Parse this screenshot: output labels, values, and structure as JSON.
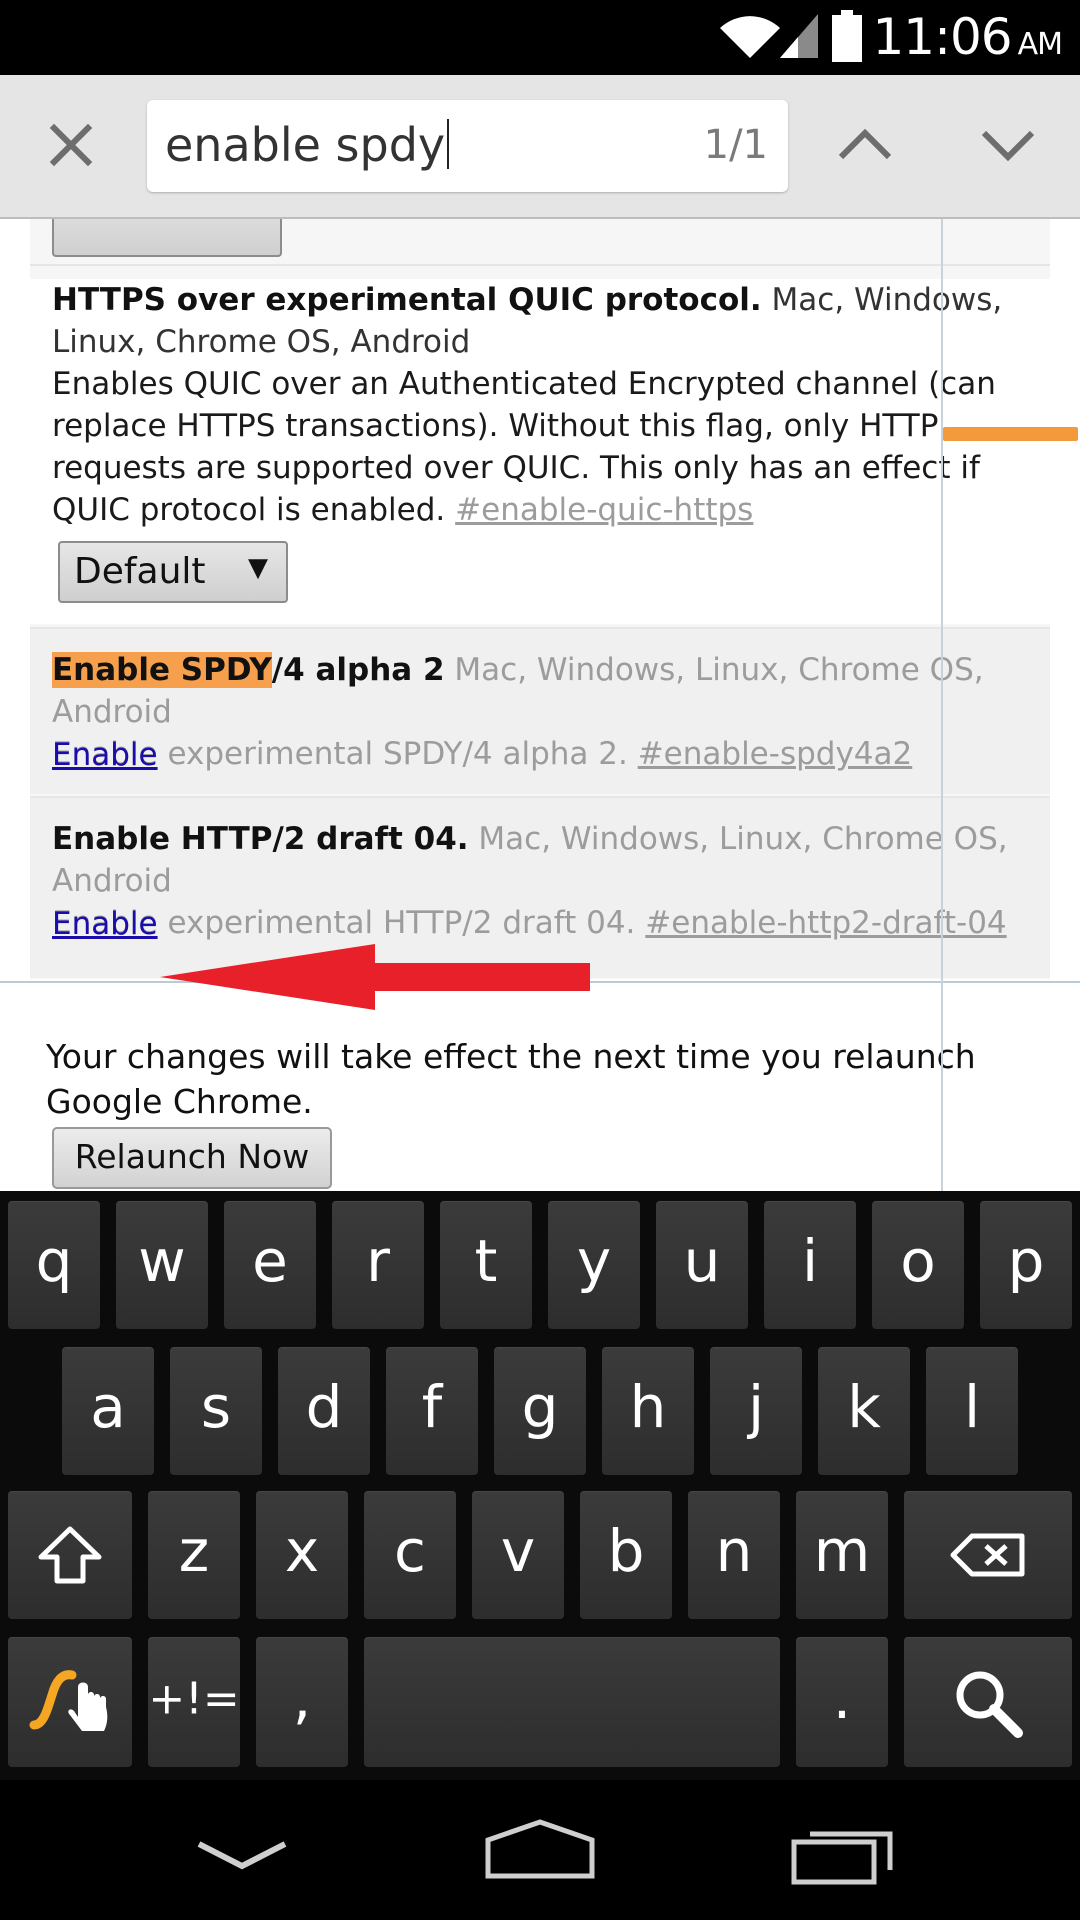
{
  "status_bar": {
    "time": "11:06",
    "ampm": "AM"
  },
  "find_bar": {
    "query": "enable spdy",
    "match_count": "1/1"
  },
  "flags": [
    {
      "title": "HTTPS over experimental QUIC protocol.",
      "platforms": "Mac, Windows, Linux, Chrome OS, Android",
      "description": "Enables QUIC over an Authenticated Encrypted channel (can replace HTTPS transactions). Without this flag, only HTTP requests are supported over QUIC. This only has an effect if QUIC protocol is enabled.",
      "anchor": "#enable-quic-https",
      "control": "Default"
    },
    {
      "title_highlight": "Enable SPDY",
      "title_rest": "/4 alpha 2",
      "platforms": "Mac, Windows, Linux, Chrome OS, Android",
      "description": "Enable experimental SPDY/4 alpha 2.",
      "anchor": "#enable-spdy4a2",
      "action": "Enable"
    },
    {
      "title": "Enable HTTP/2 draft 04.",
      "platforms": "Mac, Windows, Linux, Chrome OS, Android",
      "description": "Enable experimental HTTP/2 draft 04.",
      "anchor": "#enable-http2-draft-04",
      "action": "Enable"
    }
  ],
  "relaunch": {
    "message": "Your changes will take effect the next time you relaunch Google Chrome.",
    "button": "Relaunch Now"
  },
  "keyboard": {
    "row1": [
      "q",
      "w",
      "e",
      "r",
      "t",
      "y",
      "u",
      "i",
      "o",
      "p"
    ],
    "row2": [
      "a",
      "s",
      "d",
      "f",
      "g",
      "h",
      "j",
      "k",
      "l"
    ],
    "row3": [
      "z",
      "x",
      "c",
      "v",
      "b",
      "n",
      "m"
    ],
    "symbols_label": "+!=",
    "comma": ",",
    "period": "."
  },
  "colors": {
    "highlight": "#f6a04d",
    "link": "#1a0dab",
    "arrow": "#e8202a",
    "scroll_thumb": "#f39b3c"
  }
}
